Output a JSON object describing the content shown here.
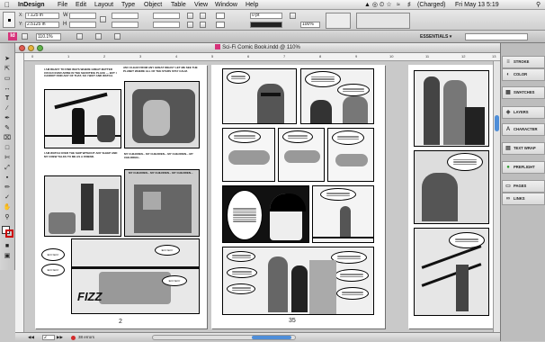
{
  "menubar": {
    "apple": "",
    "app": "InDesign",
    "items": [
      "File",
      "Edit",
      "Layout",
      "Type",
      "Object",
      "Table",
      "View",
      "Window",
      "Help"
    ],
    "battery": "(Charged)",
    "clock": "Fri May 13  5:19"
  },
  "control": {
    "x_value": "7.125 in",
    "y_value": "2.5125 in",
    "x_label": "X:",
    "y_label": "Y:",
    "stroke_weight": "0 pt",
    "scale": "100%"
  },
  "appbar": {
    "logo": "Id",
    "zoom": "110.1%",
    "workspace": "ESSENTIALS ▾"
  },
  "document": {
    "title": "Sci-Fi Comic Book.indd @ 110%",
    "ruler_marks": [
      "0",
      "1",
      "2",
      "3",
      "4",
      "5",
      "6",
      "7",
      "8",
      "9",
      "10",
      "11",
      "12",
      "13"
    ],
    "page_left_number": "2",
    "page_right_number": "35",
    "text_block_1": "I am ready to find ways where great matter could ever arise in the shooting place — but I cannot find any of that, so I wait and watch.",
    "text_block_2": "Am I clear from any great ideas? Let me see the planet where all of the stars stay calm.",
    "text_block_3": "I am watch over the ship without any sleep and my crew talks to me as a friend.",
    "text_block_4": "My children... my children... my children... my children...",
    "text_block_5": "My children... my children... my children...",
    "bubble_lines": [
      "Errrr Errrr",
      "Errrr Errrr",
      "Errrr Errrr",
      "Errrr Errrr"
    ],
    "sfx": "FIZZ"
  },
  "status": {
    "page": "2",
    "errors": "38 errors"
  },
  "panels": [
    {
      "label": "STROKE",
      "icon": "≡"
    },
    {
      "label": "COLOR",
      "icon": "◐"
    },
    {
      "label": "SWATCHES",
      "icon": "▦"
    },
    {
      "label": "LAYERS",
      "icon": "◈"
    },
    {
      "label": "CHARACTER",
      "icon": "A"
    },
    {
      "label": "TEXT WRAP",
      "icon": "▤"
    },
    {
      "label": "PREFLIGHT",
      "icon": "●"
    },
    {
      "label": "PAGES",
      "icon": "▭"
    },
    {
      "label": "LINKS",
      "icon": "∞"
    }
  ],
  "colors": {
    "indesign_logo": "#d6337a",
    "error_dot": "#d22a2a",
    "close_light": "#e05b50",
    "min_light": "#e7b43c",
    "max_light": "#5fb34a"
  }
}
